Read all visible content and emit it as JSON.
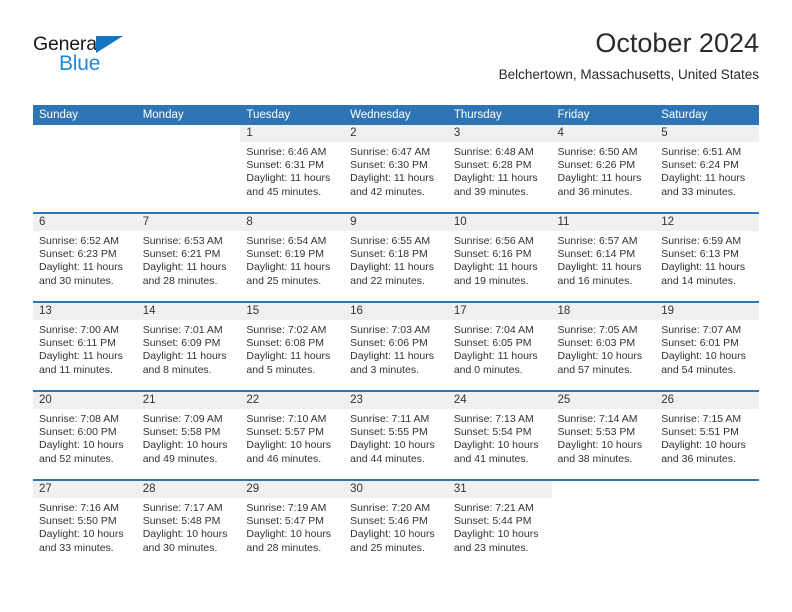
{
  "brand": {
    "name_top": "General",
    "name_bottom": "Blue",
    "triangle_color": "#1574bf",
    "blue_color": "#1f8ad6"
  },
  "header": {
    "title": "October 2024",
    "subtitle": "Belchertown, Massachusetts, United States",
    "header_bg": "#2e75b6",
    "header_text_color": "#ffffff",
    "daynum_bg": "#f0f0f0"
  },
  "weekdays": [
    "Sunday",
    "Monday",
    "Tuesday",
    "Wednesday",
    "Thursday",
    "Friday",
    "Saturday"
  ],
  "weeks": [
    [
      {
        "day": "",
        "sunrise": "",
        "sunset": "",
        "daylight1": "",
        "daylight2": "",
        "blank": true
      },
      {
        "day": "",
        "sunrise": "",
        "sunset": "",
        "daylight1": "",
        "daylight2": "",
        "blank": true
      },
      {
        "day": "1",
        "sunrise": "Sunrise: 6:46 AM",
        "sunset": "Sunset: 6:31 PM",
        "daylight1": "Daylight: 11 hours",
        "daylight2": "and 45 minutes."
      },
      {
        "day": "2",
        "sunrise": "Sunrise: 6:47 AM",
        "sunset": "Sunset: 6:30 PM",
        "daylight1": "Daylight: 11 hours",
        "daylight2": "and 42 minutes."
      },
      {
        "day": "3",
        "sunrise": "Sunrise: 6:48 AM",
        "sunset": "Sunset: 6:28 PM",
        "daylight1": "Daylight: 11 hours",
        "daylight2": "and 39 minutes."
      },
      {
        "day": "4",
        "sunrise": "Sunrise: 6:50 AM",
        "sunset": "Sunset: 6:26 PM",
        "daylight1": "Daylight: 11 hours",
        "daylight2": "and 36 minutes."
      },
      {
        "day": "5",
        "sunrise": "Sunrise: 6:51 AM",
        "sunset": "Sunset: 6:24 PM",
        "daylight1": "Daylight: 11 hours",
        "daylight2": "and 33 minutes."
      }
    ],
    [
      {
        "day": "6",
        "sunrise": "Sunrise: 6:52 AM",
        "sunset": "Sunset: 6:23 PM",
        "daylight1": "Daylight: 11 hours",
        "daylight2": "and 30 minutes."
      },
      {
        "day": "7",
        "sunrise": "Sunrise: 6:53 AM",
        "sunset": "Sunset: 6:21 PM",
        "daylight1": "Daylight: 11 hours",
        "daylight2": "and 28 minutes."
      },
      {
        "day": "8",
        "sunrise": "Sunrise: 6:54 AM",
        "sunset": "Sunset: 6:19 PM",
        "daylight1": "Daylight: 11 hours",
        "daylight2": "and 25 minutes."
      },
      {
        "day": "9",
        "sunrise": "Sunrise: 6:55 AM",
        "sunset": "Sunset: 6:18 PM",
        "daylight1": "Daylight: 11 hours",
        "daylight2": "and 22 minutes."
      },
      {
        "day": "10",
        "sunrise": "Sunrise: 6:56 AM",
        "sunset": "Sunset: 6:16 PM",
        "daylight1": "Daylight: 11 hours",
        "daylight2": "and 19 minutes."
      },
      {
        "day": "11",
        "sunrise": "Sunrise: 6:57 AM",
        "sunset": "Sunset: 6:14 PM",
        "daylight1": "Daylight: 11 hours",
        "daylight2": "and 16 minutes."
      },
      {
        "day": "12",
        "sunrise": "Sunrise: 6:59 AM",
        "sunset": "Sunset: 6:13 PM",
        "daylight1": "Daylight: 11 hours",
        "daylight2": "and 14 minutes."
      }
    ],
    [
      {
        "day": "13",
        "sunrise": "Sunrise: 7:00 AM",
        "sunset": "Sunset: 6:11 PM",
        "daylight1": "Daylight: 11 hours",
        "daylight2": "and 11 minutes."
      },
      {
        "day": "14",
        "sunrise": "Sunrise: 7:01 AM",
        "sunset": "Sunset: 6:09 PM",
        "daylight1": "Daylight: 11 hours",
        "daylight2": "and 8 minutes."
      },
      {
        "day": "15",
        "sunrise": "Sunrise: 7:02 AM",
        "sunset": "Sunset: 6:08 PM",
        "daylight1": "Daylight: 11 hours",
        "daylight2": "and 5 minutes."
      },
      {
        "day": "16",
        "sunrise": "Sunrise: 7:03 AM",
        "sunset": "Sunset: 6:06 PM",
        "daylight1": "Daylight: 11 hours",
        "daylight2": "and 3 minutes."
      },
      {
        "day": "17",
        "sunrise": "Sunrise: 7:04 AM",
        "sunset": "Sunset: 6:05 PM",
        "daylight1": "Daylight: 11 hours",
        "daylight2": "and 0 minutes."
      },
      {
        "day": "18",
        "sunrise": "Sunrise: 7:05 AM",
        "sunset": "Sunset: 6:03 PM",
        "daylight1": "Daylight: 10 hours",
        "daylight2": "and 57 minutes."
      },
      {
        "day": "19",
        "sunrise": "Sunrise: 7:07 AM",
        "sunset": "Sunset: 6:01 PM",
        "daylight1": "Daylight: 10 hours",
        "daylight2": "and 54 minutes."
      }
    ],
    [
      {
        "day": "20",
        "sunrise": "Sunrise: 7:08 AM",
        "sunset": "Sunset: 6:00 PM",
        "daylight1": "Daylight: 10 hours",
        "daylight2": "and 52 minutes."
      },
      {
        "day": "21",
        "sunrise": "Sunrise: 7:09 AM",
        "sunset": "Sunset: 5:58 PM",
        "daylight1": "Daylight: 10 hours",
        "daylight2": "and 49 minutes."
      },
      {
        "day": "22",
        "sunrise": "Sunrise: 7:10 AM",
        "sunset": "Sunset: 5:57 PM",
        "daylight1": "Daylight: 10 hours",
        "daylight2": "and 46 minutes."
      },
      {
        "day": "23",
        "sunrise": "Sunrise: 7:11 AM",
        "sunset": "Sunset: 5:55 PM",
        "daylight1": "Daylight: 10 hours",
        "daylight2": "and 44 minutes."
      },
      {
        "day": "24",
        "sunrise": "Sunrise: 7:13 AM",
        "sunset": "Sunset: 5:54 PM",
        "daylight1": "Daylight: 10 hours",
        "daylight2": "and 41 minutes."
      },
      {
        "day": "25",
        "sunrise": "Sunrise: 7:14 AM",
        "sunset": "Sunset: 5:53 PM",
        "daylight1": "Daylight: 10 hours",
        "daylight2": "and 38 minutes."
      },
      {
        "day": "26",
        "sunrise": "Sunrise: 7:15 AM",
        "sunset": "Sunset: 5:51 PM",
        "daylight1": "Daylight: 10 hours",
        "daylight2": "and 36 minutes."
      }
    ],
    [
      {
        "day": "27",
        "sunrise": "Sunrise: 7:16 AM",
        "sunset": "Sunset: 5:50 PM",
        "daylight1": "Daylight: 10 hours",
        "daylight2": "and 33 minutes."
      },
      {
        "day": "28",
        "sunrise": "Sunrise: 7:17 AM",
        "sunset": "Sunset: 5:48 PM",
        "daylight1": "Daylight: 10 hours",
        "daylight2": "and 30 minutes."
      },
      {
        "day": "29",
        "sunrise": "Sunrise: 7:19 AM",
        "sunset": "Sunset: 5:47 PM",
        "daylight1": "Daylight: 10 hours",
        "daylight2": "and 28 minutes."
      },
      {
        "day": "30",
        "sunrise": "Sunrise: 7:20 AM",
        "sunset": "Sunset: 5:46 PM",
        "daylight1": "Daylight: 10 hours",
        "daylight2": "and 25 minutes."
      },
      {
        "day": "31",
        "sunrise": "Sunrise: 7:21 AM",
        "sunset": "Sunset: 5:44 PM",
        "daylight1": "Daylight: 10 hours",
        "daylight2": "and 23 minutes."
      },
      {
        "day": "",
        "sunrise": "",
        "sunset": "",
        "daylight1": "",
        "daylight2": "",
        "blank": true
      },
      {
        "day": "",
        "sunrise": "",
        "sunset": "",
        "daylight1": "",
        "daylight2": "",
        "blank": true
      }
    ]
  ]
}
